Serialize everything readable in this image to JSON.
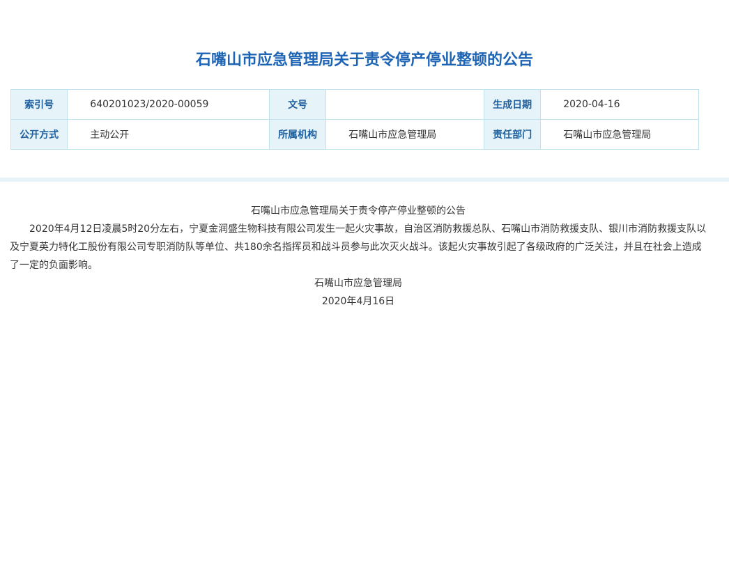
{
  "title": "石嘴山市应急管理局关于责令停产停业整顿的公告",
  "meta": [
    [
      "索引号",
      "640201023/2020-00059"
    ],
    [
      "文号",
      ""
    ],
    [
      "生成日期",
      "2020-04-16"
    ],
    [
      "公开方式",
      "主动公开"
    ],
    [
      "所属机构",
      "石嘴山市应急管理局"
    ],
    [
      "责任部门",
      "石嘴山市应急管理局"
    ]
  ],
  "doc_title": "石嘴山市应急管理局关于责令停产停业整顿的公告",
  "p1": "2020年4月12日凌晨5时20分左右，宁夏金润盛生物科技有限公司发生一起火灾事故，自治区消防救援总队、石嘴山市消防救援支队、银川市消防救援支队以及宁夏英力特化工股份有限公司专职消防队等单位、共180余名指挥员和战斗员参与此次灭火战斗。该起火灾事故引起了各级政府的广泛关注，并且在社会上造成了一定的负面影响。",
  "sign": "石嘴山市应急管理局",
  "date": "2020年4月16日"
}
